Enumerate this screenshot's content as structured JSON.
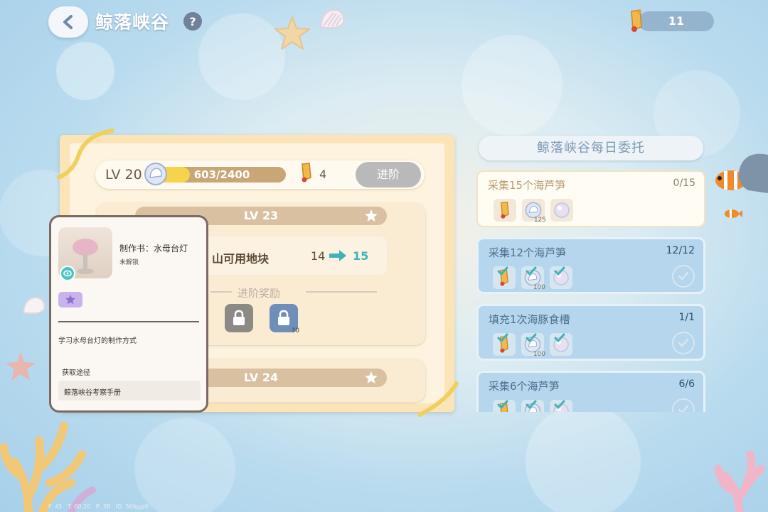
{
  "header": {
    "title": "鲸落峡谷",
    "help_label": "?",
    "currency_value": "11"
  },
  "level_panel": {
    "level_label": "LV 20",
    "exp_text": "603/2400",
    "exp_fraction": 0.25,
    "scroll_count": "4",
    "advance_label": "进阶",
    "next_levels": [
      {
        "label": "LV 23",
        "unlock_label": "山可用地块",
        "from": "14",
        "to": "15",
        "reward_title": "进阶奖励",
        "reward_counts": [
          "",
          "30"
        ]
      },
      {
        "label": "LV 24"
      }
    ]
  },
  "tooltip": {
    "title": "制作书：水母台灯",
    "status": "未解锁",
    "description": "学习水母台灯的制作方式",
    "source_label": "获取途径",
    "source_value": "鲸落峡谷考察手册"
  },
  "daily_tasks": {
    "title": "鲸落峡谷每日委托",
    "items": [
      {
        "name": "采集15个海芦笋",
        "progress": "0/15",
        "state": "active",
        "rewards": [
          {
            "icon": "scroll-icon",
            "count": ""
          },
          {
            "icon": "shell-coin-icon",
            "count": "125"
          },
          {
            "icon": "pearl-icon",
            "count": ""
          }
        ]
      },
      {
        "name": "采集12个海芦笋",
        "progress": "12/12",
        "state": "done",
        "rewards": [
          {
            "icon": "scroll-icon",
            "count": ""
          },
          {
            "icon": "shell-coin-icon",
            "count": "100"
          },
          {
            "icon": "pearl-icon",
            "count": ""
          }
        ]
      },
      {
        "name": "填充1次海豚食槽",
        "progress": "1/1",
        "state": "done",
        "rewards": [
          {
            "icon": "scroll-icon",
            "count": ""
          },
          {
            "icon": "shell-coin-icon",
            "count": "100"
          },
          {
            "icon": "pearl-icon",
            "count": ""
          }
        ]
      },
      {
        "name": "采集6个海芦笋",
        "progress": "6/6",
        "state": "done",
        "rewards": [
          {
            "icon": "scroll-icon",
            "count": ""
          },
          {
            "icon": "shell-coin-icon",
            "count": ""
          },
          {
            "icon": "pearl-icon",
            "count": ""
          }
        ]
      }
    ]
  },
  "debug_text": "F: 45   T: 60.20   P: 38   ID: 56fggz6",
  "colors": {
    "teal_accent": "#3fb3b8",
    "exp_fill": "#f6d34a",
    "task_done_bg": "#b5d6ec",
    "parchment": "#fbe5b8"
  }
}
